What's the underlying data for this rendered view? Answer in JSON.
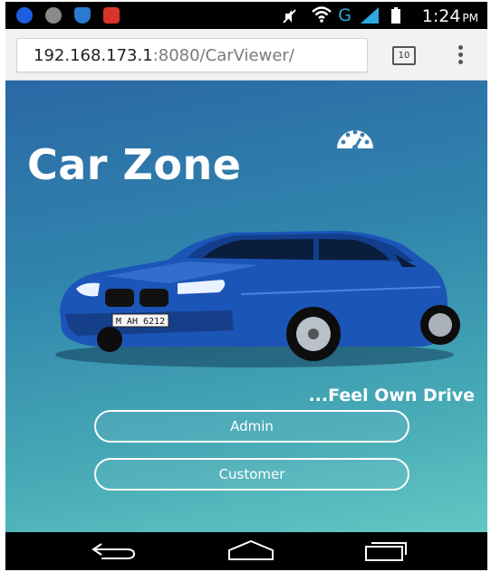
{
  "status_bar": {
    "time": "1:24",
    "ampm": "PM",
    "network_label": "G"
  },
  "browser": {
    "url_host": "192.168.173.1",
    "url_rest": ":8080/CarViewer/",
    "tab_count": "10"
  },
  "page": {
    "title": "Car Zone",
    "tagline": "...Feel Own Drive",
    "car_plate": "M AH 6212",
    "buttons": {
      "admin": "Admin",
      "customer": "Customer"
    }
  },
  "colors": {
    "gradient_top": "#2a68a6",
    "gradient_bottom": "#62c7c4",
    "car_blue": "#1c55b8"
  },
  "icons": {
    "speedometer": "speedometer-icon",
    "back": "back-icon",
    "home": "home-icon",
    "recents": "recent-apps-icon"
  }
}
